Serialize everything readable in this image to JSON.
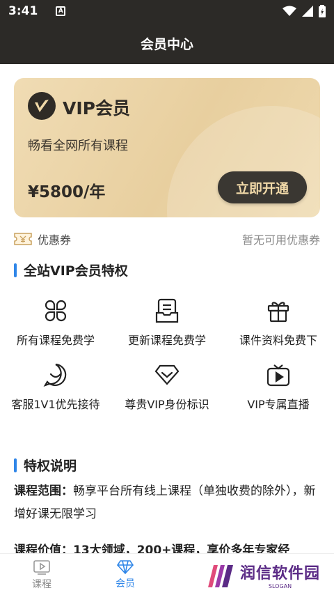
{
  "status_bar": {
    "time": "3:41",
    "a_icon": "A"
  },
  "header": {
    "title": "会员中心"
  },
  "vip_card": {
    "title": "VIP会员",
    "subtitle": "畅看全网所有课程",
    "price": "¥5800/年",
    "button": "立即开通"
  },
  "coupon": {
    "label": "优惠券",
    "status": "暂无可用优惠券"
  },
  "perks_section": {
    "title": "全站VIP会员特权",
    "items": [
      {
        "label": "所有课程免费学",
        "icon": "grid-clover-icon"
      },
      {
        "label": "更新课程免费学",
        "icon": "document-icon"
      },
      {
        "label": "课件资料免费下",
        "icon": "gift-icon"
      },
      {
        "label": "客服1V1优先接待",
        "icon": "smile-chat-icon"
      },
      {
        "label": "尊贵VIP身份标识",
        "icon": "diamond-icon"
      },
      {
        "label": "VIP专属直播",
        "icon": "tv-play-icon"
      }
    ]
  },
  "privilege_section": {
    "title": "特权说明",
    "para1_label": "课程范围：",
    "para1_text": "畅享平台所有线上课程（单独收费的除外），新增好课无限学习",
    "para2_partial": "课程价值：13大领域，200+课程，享价多年专家经"
  },
  "tabbar": {
    "tabs": [
      {
        "label": "课程",
        "icon": "video-play-icon",
        "active": false
      },
      {
        "label": "会员",
        "icon": "diamond-icon",
        "active": true
      }
    ]
  },
  "watermark": {
    "text": "润信软件园",
    "slogan": "SLOGAN"
  },
  "colors": {
    "dark": "#2c2a27",
    "gold": "#e8cf9f",
    "accent_blue": "#2f86e8",
    "tab_active": "#2f86e8"
  }
}
